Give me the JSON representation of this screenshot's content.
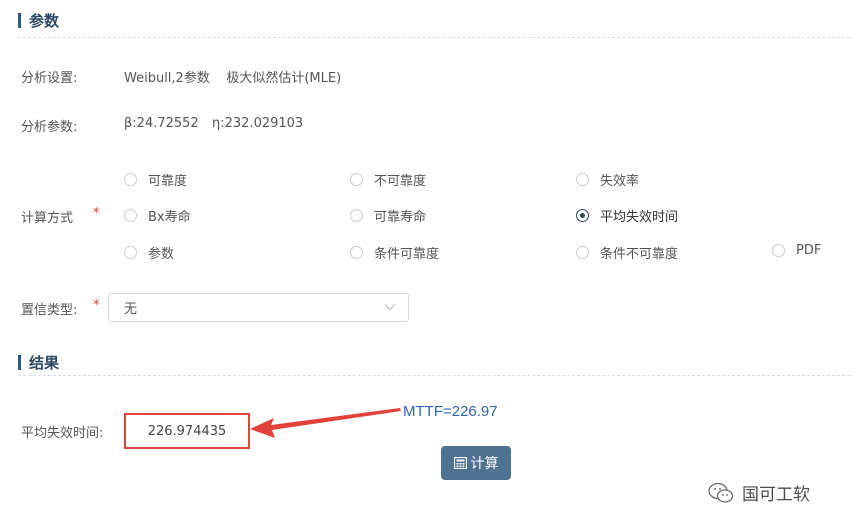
{
  "params_section": {
    "title": "参数"
  },
  "analysis_setting": {
    "label": "分析设置:",
    "value": "Weibull,2参数    极大似然估计(MLE)"
  },
  "analysis_params": {
    "label": "分析参数:",
    "beta": "β:24.72552",
    "eta": "η:232.029103"
  },
  "calc_method": {
    "label": "计算方式",
    "required_mark": "*",
    "options": [
      {
        "label": "可靠度",
        "checked": false
      },
      {
        "label": "不可靠度",
        "checked": false
      },
      {
        "label": "失效率",
        "checked": false
      },
      {
        "label": "Bx寿命",
        "checked": false
      },
      {
        "label": "可靠寿命",
        "checked": false
      },
      {
        "label": "平均失效时间",
        "checked": true
      },
      {
        "label": "参数",
        "checked": false
      },
      {
        "label": "条件可靠度",
        "checked": false
      },
      {
        "label": "条件不可靠度",
        "checked": false
      },
      {
        "label": "PDF",
        "checked": false
      }
    ]
  },
  "confidence_type": {
    "label": "置信类型:",
    "required_mark": "*",
    "selected": "无"
  },
  "result_section": {
    "title": "结果"
  },
  "result": {
    "label": "平均失效时间:",
    "value": "226.974435"
  },
  "annotation": {
    "text": "MTTF=226.97",
    "color": "#2f64b4"
  },
  "calc_button": {
    "label": "计算",
    "icon": "calculator-icon"
  },
  "watermark": {
    "text": "国可工软",
    "icon": "wechat-icon"
  },
  "colors": {
    "accent": "#2c4a66",
    "required": "#e0393e",
    "highlight": "#e2413c",
    "button": "#4f7291"
  }
}
